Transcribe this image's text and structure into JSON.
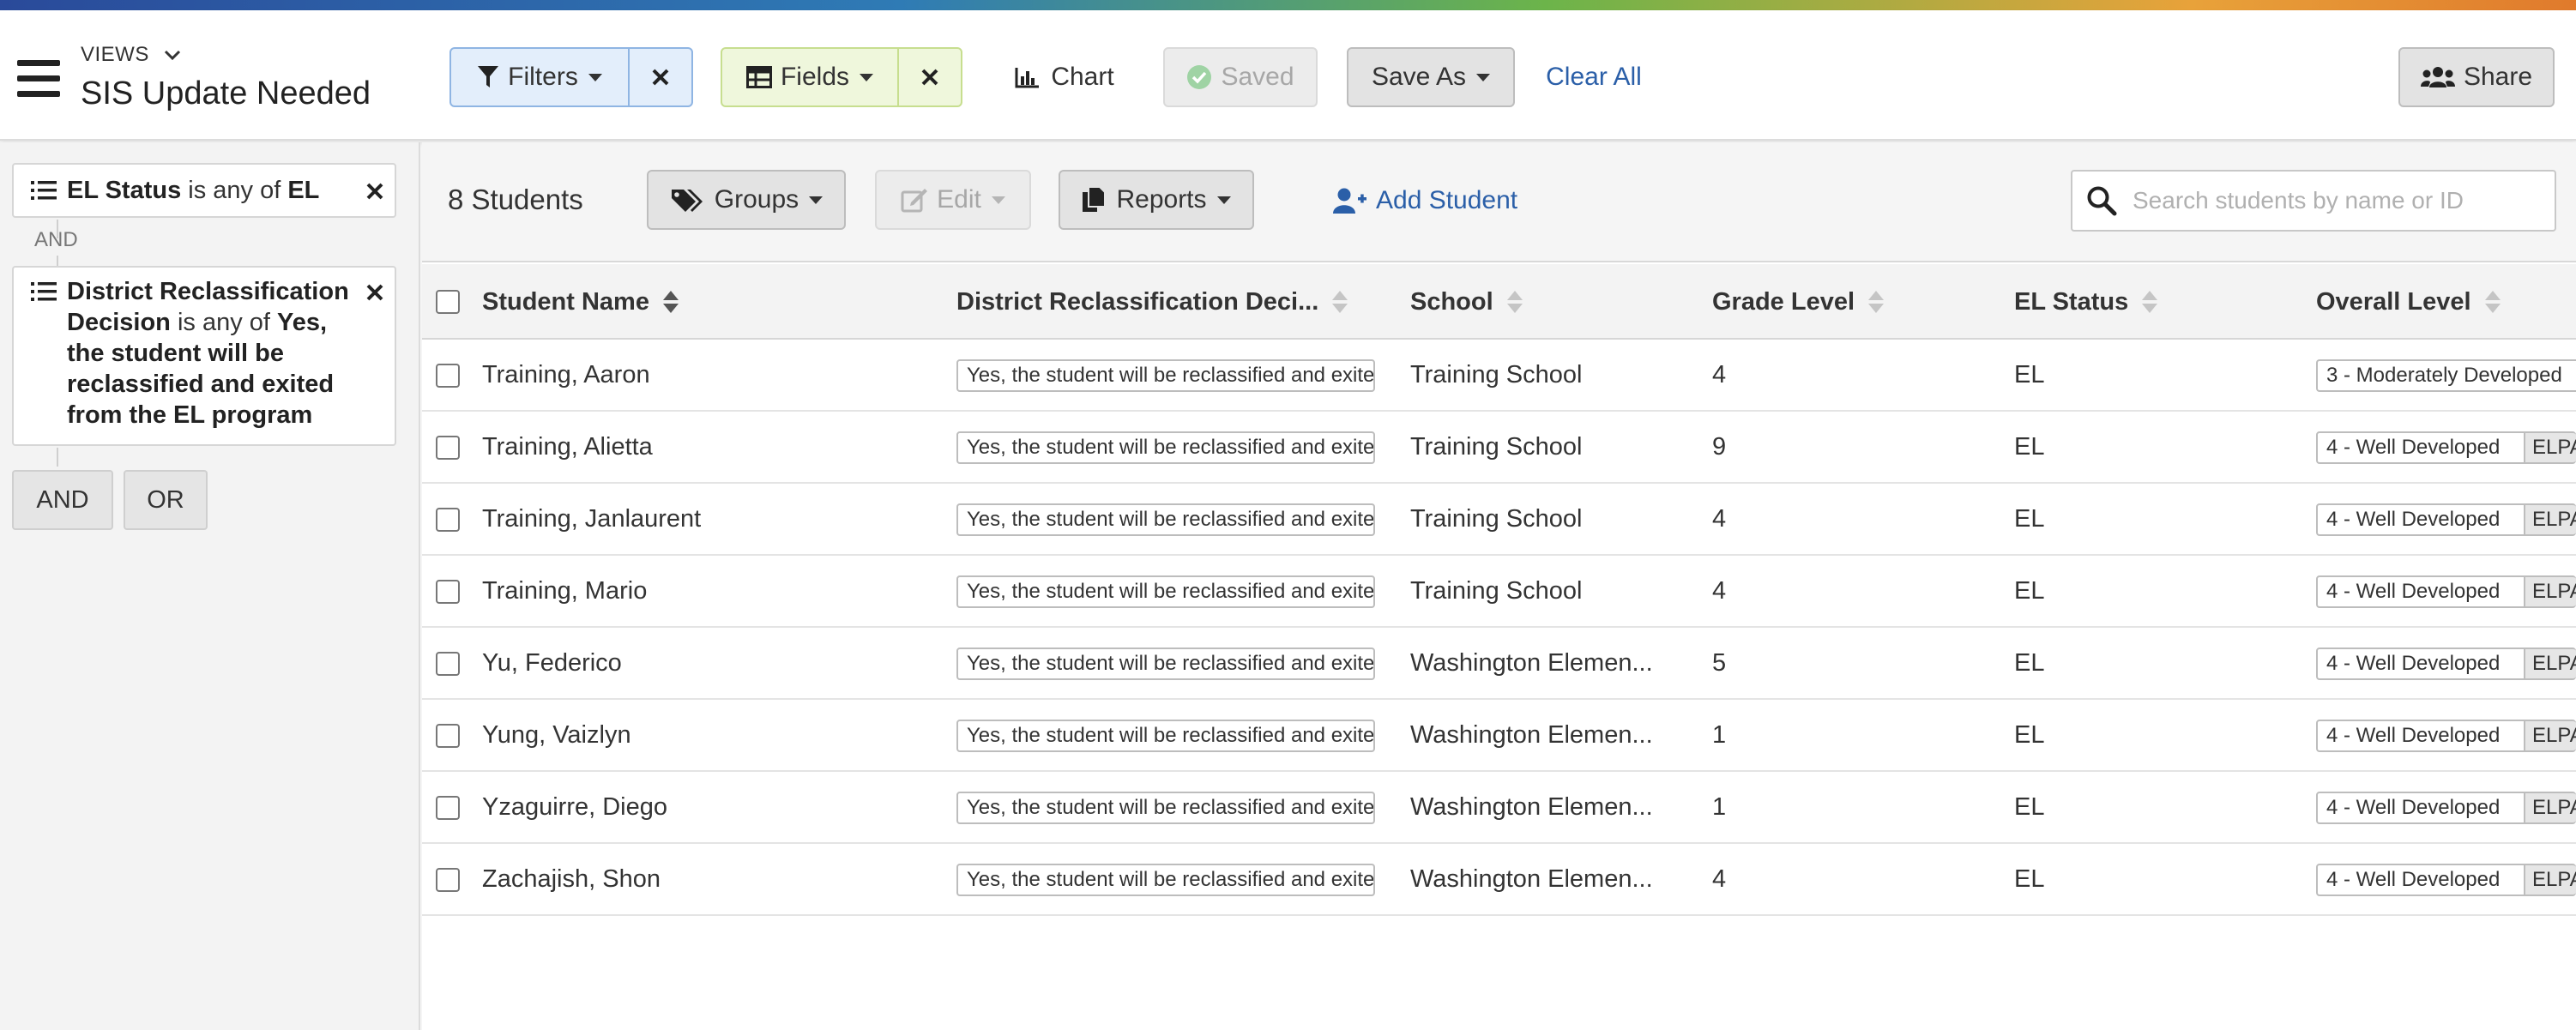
{
  "header": {
    "views_label": "VIEWS",
    "title": "SIS Update Needed",
    "filters_label": "Filters",
    "fields_label": "Fields",
    "chart_label": "Chart",
    "saved_label": "Saved",
    "save_as_label": "Save As",
    "clear_all_label": "Clear All",
    "share_label": "Share"
  },
  "sidebar": {
    "filter1": {
      "field": "EL Status",
      "op": "is any of",
      "value": "EL"
    },
    "filter2": {
      "field_line1": "District Reclassification",
      "field_line2": "Decision",
      "op": "is any of",
      "value_first": "Yes,",
      "value_line2": "the student will be",
      "value_line3": "reclassified and exited",
      "value_line4": "from the EL program"
    },
    "and_label": "AND",
    "and_button": "AND",
    "or_button": "OR"
  },
  "toolbar": {
    "count": "8 Students",
    "groups_label": "Groups",
    "edit_label": "Edit",
    "reports_label": "Reports",
    "add_student_label": "Add Student",
    "search_placeholder": "Search students by name or ID"
  },
  "table": {
    "columns": [
      "Student Name",
      "District Reclassification Deci...",
      "School",
      "Grade Level",
      "EL Status",
      "Overall Level"
    ],
    "rows": [
      {
        "name": "Training, Aaron",
        "decision": "Yes, the student will be reclassified and exited from the EL program",
        "school": "Training School",
        "grade": "4",
        "el": "EL",
        "level": "3 - Moderately Developed",
        "tag": ""
      },
      {
        "name": "Training, Alietta",
        "decision": "Yes, the student will be reclassified and exited from the EL program",
        "school": "Training School",
        "grade": "9",
        "el": "EL",
        "level": "4 - Well Developed",
        "tag": "ELPAC"
      },
      {
        "name": "Training, Janlaurent",
        "decision": "Yes, the student will be reclassified and exited from the EL program",
        "school": "Training School",
        "grade": "4",
        "el": "EL",
        "level": "4 - Well Developed",
        "tag": "ELPAC"
      },
      {
        "name": "Training, Mario",
        "decision": "Yes, the student will be reclassified and exited from the EL program",
        "school": "Training School",
        "grade": "4",
        "el": "EL",
        "level": "4 - Well Developed",
        "tag": "ELPAC"
      },
      {
        "name": "Yu, Federico",
        "decision": "Yes, the student will be reclassified and exited from the EL program",
        "school": "Washington Elemen...",
        "grade": "5",
        "el": "EL",
        "level": "4 - Well Developed",
        "tag": "ELPAC"
      },
      {
        "name": "Yung, Vaizlyn",
        "decision": "Yes, the student will be reclassified and exited from the EL program",
        "school": "Washington Elemen...",
        "grade": "1",
        "el": "EL",
        "level": "4 - Well Developed",
        "tag": "ELPAC"
      },
      {
        "name": "Yzaguirre, Diego",
        "decision": "Yes, the student will be reclassified and exited from the EL program",
        "school": "Washington Elemen...",
        "grade": "1",
        "el": "EL",
        "level": "4 - Well Developed",
        "tag": "ELPAC"
      },
      {
        "name": "Zachajish, Shon",
        "decision": "Yes, the student will be reclassified and exited from the EL program",
        "school": "Washington Elemen...",
        "grade": "4",
        "el": "EL",
        "level": "4 - Well Developed",
        "tag": "ELPAC"
      }
    ]
  },
  "colors": {
    "accent_blue": "#2b5fa8",
    "filters_bg": "#e3eefb",
    "fields_bg": "#eff7dc",
    "saved_check": "#9fd3a4"
  }
}
